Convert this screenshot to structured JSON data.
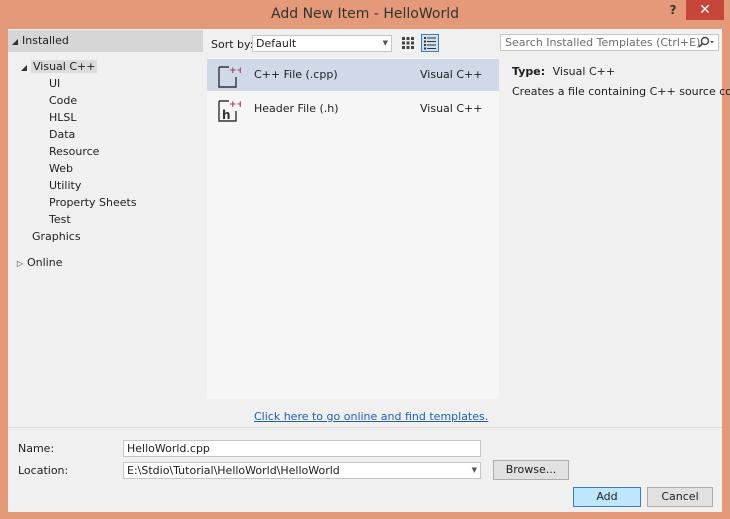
{
  "window": {
    "title": "Add New Item - HelloWorld",
    "help_label": "?",
    "close_label": "✕"
  },
  "tree": {
    "installed": "Installed",
    "visual_cpp": "Visual C++",
    "children": [
      "UI",
      "Code",
      "HLSL",
      "Data",
      "Resource",
      "Web",
      "Utility",
      "Property Sheets",
      "Test"
    ],
    "graphics": "Graphics",
    "online": "Online"
  },
  "sort": {
    "label": "Sort by:",
    "value": "Default"
  },
  "items": [
    {
      "name": "C++ File (.cpp)",
      "lang": "Visual C++",
      "icon": "cpp-file-icon"
    },
    {
      "name": "Header File (.h)",
      "lang": "Visual C++",
      "icon": "header-file-icon"
    }
  ],
  "online_link": "Click here to go online and find templates.",
  "search": {
    "placeholder": "Search Installed Templates (Ctrl+E)"
  },
  "details": {
    "type_label": "Type:",
    "type_value": "Visual C++",
    "description": "Creates a file containing C++ source code"
  },
  "form": {
    "name_label": "Name:",
    "name_value": "HelloWorld.cpp",
    "location_label": "Location:",
    "location_value": "E:\\Stdio\\Tutorial\\HelloWorld\\HelloWorld",
    "browse_label": "Browse...",
    "add_label": "Add",
    "cancel_label": "Cancel"
  },
  "colors": {
    "frame": "#e49a78",
    "close": "#c7463a",
    "accent": "#3c7fb1",
    "link": "#1e5fb4"
  }
}
